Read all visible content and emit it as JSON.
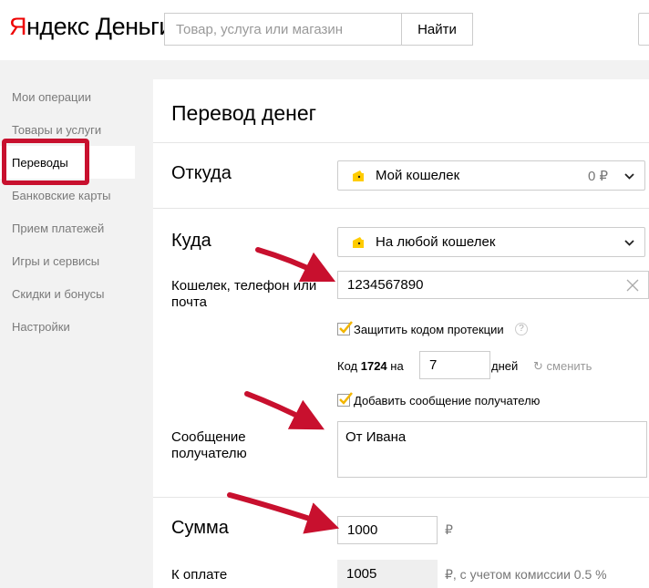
{
  "header": {
    "logo_first": "Я",
    "logo_rest": "ндекс Деньги",
    "search_placeholder": "Товар, услуга или магазин",
    "search_button": "Найти"
  },
  "sidebar": {
    "items": [
      {
        "label": "Мои операции"
      },
      {
        "label": "Товары и услуги"
      },
      {
        "label": "Переводы",
        "active": true
      },
      {
        "label": "Банковские карты"
      },
      {
        "label": "Прием платежей"
      },
      {
        "label": "Игры и сервисы"
      },
      {
        "label": "Скидки и бонусы"
      },
      {
        "label": "Настройки"
      }
    ]
  },
  "form": {
    "title": "Перевод денег",
    "from": {
      "label": "Откуда",
      "wallet": "Мой кошелек",
      "balance": "0 ₽"
    },
    "to": {
      "label": "Куда",
      "wallet": "На любой кошелек",
      "recipient_label": "Кошелек, телефон или почта",
      "recipient_value": "1234567890"
    },
    "protect": {
      "label": "Защитить кодом протекции",
      "help": "?",
      "code_prefix": "Код",
      "code": "1724",
      "code_on": "на",
      "days_value": "7",
      "days_label": "дней",
      "refresh_label": "сменить"
    },
    "message": {
      "checkbox_label": "Добавить сообщение получателю",
      "label": "Сообщение получателю",
      "value": "От Ивана"
    },
    "amount": {
      "label": "Сумма",
      "value": "1000",
      "currency": "₽"
    },
    "to_pay": {
      "label": "К оплате",
      "value": "1005",
      "note": "₽, с учетом комиссии 0.5 %"
    }
  },
  "colors": {
    "brand_red": "#e00000",
    "highlight": "#c8102e",
    "wallet_yellow": "#ffcc00",
    "arrow": "#c8102e"
  }
}
